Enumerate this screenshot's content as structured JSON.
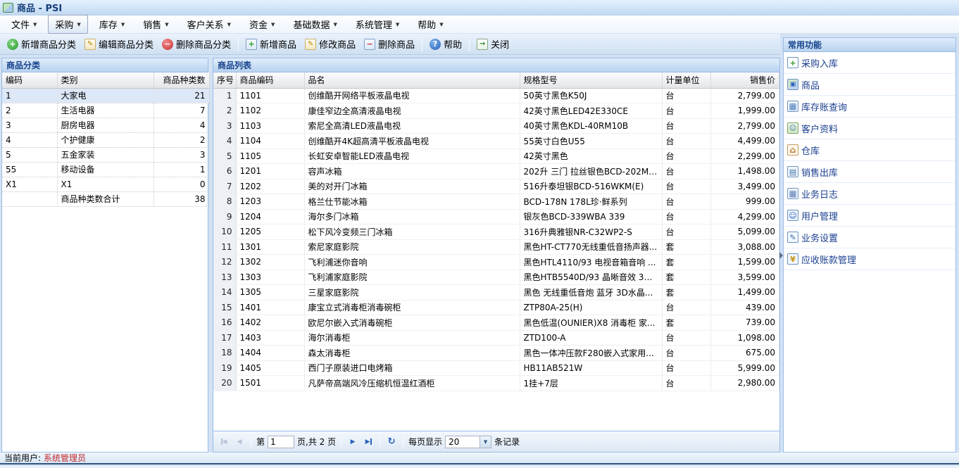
{
  "window": {
    "title": "商品 - PSI"
  },
  "menubar": {
    "items": [
      {
        "label": "文件",
        "name": "menu-file",
        "active": false
      },
      {
        "label": "采购",
        "name": "menu-purchase",
        "active": true
      },
      {
        "label": "库存",
        "name": "menu-inventory",
        "active": false
      },
      {
        "label": "销售",
        "name": "menu-sales",
        "active": false
      },
      {
        "label": "客户关系",
        "name": "menu-customer-relations",
        "active": false
      },
      {
        "label": "资金",
        "name": "menu-funds",
        "active": false
      },
      {
        "label": "基础数据",
        "name": "menu-base-data",
        "active": false
      },
      {
        "label": "系统管理",
        "name": "menu-system-admin",
        "active": false
      },
      {
        "label": "帮助",
        "name": "menu-help",
        "active": false
      }
    ]
  },
  "toolbar": {
    "buttons": [
      {
        "label": "新增商品分类",
        "name": "add-category-button",
        "icon": "add-category",
        "glyph": "+",
        "sep_before": false
      },
      {
        "label": "编辑商品分类",
        "name": "edit-category-button",
        "icon": "edit-category",
        "glyph": "✎",
        "sep_before": false
      },
      {
        "label": "删除商品分类",
        "name": "delete-category-button",
        "icon": "delete-category",
        "glyph": "−",
        "sep_before": false
      },
      {
        "label": "新增商品",
        "name": "add-product-button",
        "icon": "add-product",
        "glyph": "+",
        "sep_before": true
      },
      {
        "label": "修改商品",
        "name": "modify-product-button",
        "icon": "modify-product",
        "glyph": "✎",
        "sep_before": false
      },
      {
        "label": "删除商品",
        "name": "delete-product-button",
        "icon": "delete-product",
        "glyph": "−",
        "sep_before": false
      },
      {
        "label": "帮助",
        "name": "help-button",
        "icon": "help",
        "glyph": "?",
        "sep_before": true
      },
      {
        "label": "关闭",
        "name": "close-button",
        "icon": "close",
        "glyph": "→",
        "sep_before": true
      }
    ]
  },
  "category_panel": {
    "title": "商品分类",
    "columns": [
      "编码",
      "类别",
      "商品种类数"
    ],
    "selected_row_index": 0,
    "rows": [
      {
        "code": "1",
        "category": "大家电",
        "count": "21"
      },
      {
        "code": "2",
        "category": "生活电器",
        "count": "7"
      },
      {
        "code": "3",
        "category": "厨房电器",
        "count": "4"
      },
      {
        "code": "4",
        "category": "个护健康",
        "count": "2"
      },
      {
        "code": "5",
        "category": "五金家装",
        "count": "3"
      },
      {
        "code": "55",
        "category": "移动设备",
        "count": "1"
      },
      {
        "code": "X1",
        "category": "X1",
        "count": "0"
      }
    ],
    "footer": {
      "code": "",
      "label": "商品种类数合计",
      "total": "38"
    }
  },
  "product_panel": {
    "title": "商品列表",
    "columns": [
      "序号",
      "商品编码",
      "品名",
      "规格型号",
      "计量单位",
      "销售价"
    ],
    "rows": [
      {
        "seq": "1",
        "code": "1101",
        "name": "创维酷开网络平板液晶电视",
        "spec": "50英寸黑色K50J",
        "unit": "台",
        "price": "2,799.00"
      },
      {
        "seq": "2",
        "code": "1102",
        "name": "康佳窄边全高清液晶电视",
        "spec": "42英寸黑色LED42E330CE",
        "unit": "台",
        "price": "1,999.00"
      },
      {
        "seq": "3",
        "code": "1103",
        "name": "索尼全高清LED液晶电视",
        "spec": "40英寸黑色KDL-40RM10B",
        "unit": "台",
        "price": "2,799.00"
      },
      {
        "seq": "4",
        "code": "1104",
        "name": "创维酷开4K超高清平板液晶电视",
        "spec": "55英寸白色U55",
        "unit": "台",
        "price": "4,499.00"
      },
      {
        "seq": "5",
        "code": "1105",
        "name": "长虹安卓智能LED液晶电视",
        "spec": "42英寸黑色",
        "unit": "台",
        "price": "2,299.00"
      },
      {
        "seq": "6",
        "code": "1201",
        "name": "容声冰箱",
        "spec": "202升 三门 拉丝银色BCD-202M/...",
        "unit": "台",
        "price": "1,498.00"
      },
      {
        "seq": "7",
        "code": "1202",
        "name": "美的对开门冰箱",
        "spec": "516升泰坦银BCD-516WKM(E)",
        "unit": "台",
        "price": "3,499.00"
      },
      {
        "seq": "8",
        "code": "1203",
        "name": "格兰仕节能冰箱",
        "spec": "BCD-178N 178L珍·鲜系列",
        "unit": "台",
        "price": "999.00"
      },
      {
        "seq": "9",
        "code": "1204",
        "name": "海尔多门冰箱",
        "spec": "银灰色BCD-339WBA 339",
        "unit": "台",
        "price": "4,299.00"
      },
      {
        "seq": "10",
        "code": "1205",
        "name": "松下风冷变频三门冰箱",
        "spec": "316升典雅银NR-C32WP2-S",
        "unit": "台",
        "price": "5,099.00"
      },
      {
        "seq": "11",
        "code": "1301",
        "name": "索尼家庭影院",
        "spec": "黑色HT-CT770无线重低音扬声器...",
        "unit": "套",
        "price": "3,088.00"
      },
      {
        "seq": "12",
        "code": "1302",
        "name": "飞利浦迷你音响",
        "spec": "黑色HTL4110/93 电视音箱音响 ...",
        "unit": "套",
        "price": "1,599.00"
      },
      {
        "seq": "13",
        "code": "1303",
        "name": "飞利浦家庭影院",
        "spec": "黑色HTB5540D/93 晶晰音效 3D...",
        "unit": "套",
        "price": "3,599.00"
      },
      {
        "seq": "14",
        "code": "1305",
        "name": "三星家庭影院",
        "spec": "黑色 无线重低音炮 蓝牙 3D水晶...",
        "unit": "套",
        "price": "1,499.00"
      },
      {
        "seq": "15",
        "code": "1401",
        "name": "康宝立式消毒柜消毒碗柜",
        "spec": "ZTP80A-25(H)",
        "unit": "台",
        "price": "439.00"
      },
      {
        "seq": "16",
        "code": "1402",
        "name": "欧尼尔嵌入式消毒碗柜",
        "spec": "黑色低温(OUNIER)X8 消毒柜 家...",
        "unit": "套",
        "price": "739.00"
      },
      {
        "seq": "17",
        "code": "1403",
        "name": "海尔消毒柜",
        "spec": "ZTD100-A",
        "unit": "台",
        "price": "1,098.00"
      },
      {
        "seq": "18",
        "code": "1404",
        "name": "森太消毒柜",
        "spec": "黑色一体冲压款F280嵌入式家用...",
        "unit": "台",
        "price": "675.00"
      },
      {
        "seq": "19",
        "code": "1405",
        "name": "西门子原装进口电烤箱",
        "spec": "HB11AB521W",
        "unit": "台",
        "price": "5,999.00"
      },
      {
        "seq": "20",
        "code": "1501",
        "name": "凡萨帝高端风冷压缩机恒温红酒柜",
        "spec": "1挂+7层",
        "unit": "台",
        "price": "2,980.00"
      }
    ],
    "pagination": {
      "page_label": "第",
      "page_value": "1",
      "total_label": "页,共 2 页",
      "per_page_label": "每页显示",
      "per_page_value": "20",
      "records_label": "条记录"
    }
  },
  "shortcut_panel": {
    "title": "常用功能",
    "items": [
      {
        "label": "采购入库",
        "name": "shortcut-purchase-inbound",
        "icon": "purchase-inbound",
        "glyph": "+"
      },
      {
        "label": "商品",
        "name": "shortcut-product",
        "icon": "product",
        "glyph": "▣"
      },
      {
        "label": "库存账查询",
        "name": "shortcut-inventory-query",
        "icon": "inventory-query",
        "glyph": "▦"
      },
      {
        "label": "客户资料",
        "name": "shortcut-customer-info",
        "icon": "customer-info",
        "glyph": "☺"
      },
      {
        "label": "仓库",
        "name": "shortcut-warehouse",
        "icon": "warehouse",
        "glyph": "⌂"
      },
      {
        "label": "销售出库",
        "name": "shortcut-sales-outbound",
        "icon": "sales-outbound",
        "glyph": "▤"
      },
      {
        "label": "业务日志",
        "name": "shortcut-business-log",
        "icon": "business-log",
        "glyph": "▦"
      },
      {
        "label": "用户管理",
        "name": "shortcut-user-management",
        "icon": "user-management",
        "glyph": "☺"
      },
      {
        "label": "业务设置",
        "name": "shortcut-business-settings",
        "icon": "business-settings",
        "glyph": "✎"
      },
      {
        "label": "应收账款管理",
        "name": "shortcut-receivable",
        "icon": "receivable",
        "glyph": "¥"
      }
    ]
  },
  "statusbar": {
    "label": "当前用户:",
    "user": "系统管理员"
  },
  "colors": {
    "accent": "#15428b",
    "panel_border": "#99bbe8",
    "selected_row": "#dce8f8",
    "status_user": "#c22a2a",
    "link_text": "#1b3f8f"
  }
}
